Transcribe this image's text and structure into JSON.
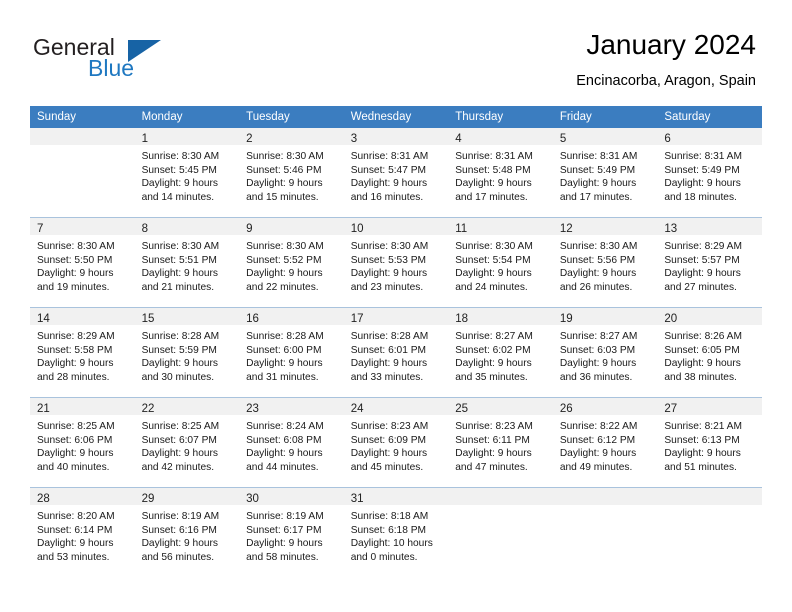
{
  "logo": {
    "word1": "General",
    "word2": "Blue",
    "triangle_color": "#1763a5",
    "blue_color": "#1f78c1"
  },
  "header": {
    "title": "January 2024",
    "subtitle": "Encinacorba, Aragon, Spain"
  },
  "theme": {
    "header_row_bg": "#3b7dc0",
    "daynum_bg": "#f1f1f1",
    "grid_line": "#a9c3dd"
  },
  "calendar": {
    "weekday_headers": [
      "Sunday",
      "Monday",
      "Tuesday",
      "Wednesday",
      "Thursday",
      "Friday",
      "Saturday"
    ],
    "weeks": [
      [
        {
          "day": "",
          "sunrise": "",
          "sunset": "",
          "daylight1": "",
          "daylight2": ""
        },
        {
          "day": "1",
          "sunrise": "Sunrise: 8:30 AM",
          "sunset": "Sunset: 5:45 PM",
          "daylight1": "Daylight: 9 hours",
          "daylight2": "and 14 minutes."
        },
        {
          "day": "2",
          "sunrise": "Sunrise: 8:30 AM",
          "sunset": "Sunset: 5:46 PM",
          "daylight1": "Daylight: 9 hours",
          "daylight2": "and 15 minutes."
        },
        {
          "day": "3",
          "sunrise": "Sunrise: 8:31 AM",
          "sunset": "Sunset: 5:47 PM",
          "daylight1": "Daylight: 9 hours",
          "daylight2": "and 16 minutes."
        },
        {
          "day": "4",
          "sunrise": "Sunrise: 8:31 AM",
          "sunset": "Sunset: 5:48 PM",
          "daylight1": "Daylight: 9 hours",
          "daylight2": "and 17 minutes."
        },
        {
          "day": "5",
          "sunrise": "Sunrise: 8:31 AM",
          "sunset": "Sunset: 5:49 PM",
          "daylight1": "Daylight: 9 hours",
          "daylight2": "and 17 minutes."
        },
        {
          "day": "6",
          "sunrise": "Sunrise: 8:31 AM",
          "sunset": "Sunset: 5:49 PM",
          "daylight1": "Daylight: 9 hours",
          "daylight2": "and 18 minutes."
        }
      ],
      [
        {
          "day": "7",
          "sunrise": "Sunrise: 8:30 AM",
          "sunset": "Sunset: 5:50 PM",
          "daylight1": "Daylight: 9 hours",
          "daylight2": "and 19 minutes."
        },
        {
          "day": "8",
          "sunrise": "Sunrise: 8:30 AM",
          "sunset": "Sunset: 5:51 PM",
          "daylight1": "Daylight: 9 hours",
          "daylight2": "and 21 minutes."
        },
        {
          "day": "9",
          "sunrise": "Sunrise: 8:30 AM",
          "sunset": "Sunset: 5:52 PM",
          "daylight1": "Daylight: 9 hours",
          "daylight2": "and 22 minutes."
        },
        {
          "day": "10",
          "sunrise": "Sunrise: 8:30 AM",
          "sunset": "Sunset: 5:53 PM",
          "daylight1": "Daylight: 9 hours",
          "daylight2": "and 23 minutes."
        },
        {
          "day": "11",
          "sunrise": "Sunrise: 8:30 AM",
          "sunset": "Sunset: 5:54 PM",
          "daylight1": "Daylight: 9 hours",
          "daylight2": "and 24 minutes."
        },
        {
          "day": "12",
          "sunrise": "Sunrise: 8:30 AM",
          "sunset": "Sunset: 5:56 PM",
          "daylight1": "Daylight: 9 hours",
          "daylight2": "and 26 minutes."
        },
        {
          "day": "13",
          "sunrise": "Sunrise: 8:29 AM",
          "sunset": "Sunset: 5:57 PM",
          "daylight1": "Daylight: 9 hours",
          "daylight2": "and 27 minutes."
        }
      ],
      [
        {
          "day": "14",
          "sunrise": "Sunrise: 8:29 AM",
          "sunset": "Sunset: 5:58 PM",
          "daylight1": "Daylight: 9 hours",
          "daylight2": "and 28 minutes."
        },
        {
          "day": "15",
          "sunrise": "Sunrise: 8:28 AM",
          "sunset": "Sunset: 5:59 PM",
          "daylight1": "Daylight: 9 hours",
          "daylight2": "and 30 minutes."
        },
        {
          "day": "16",
          "sunrise": "Sunrise: 8:28 AM",
          "sunset": "Sunset: 6:00 PM",
          "daylight1": "Daylight: 9 hours",
          "daylight2": "and 31 minutes."
        },
        {
          "day": "17",
          "sunrise": "Sunrise: 8:28 AM",
          "sunset": "Sunset: 6:01 PM",
          "daylight1": "Daylight: 9 hours",
          "daylight2": "and 33 minutes."
        },
        {
          "day": "18",
          "sunrise": "Sunrise: 8:27 AM",
          "sunset": "Sunset: 6:02 PM",
          "daylight1": "Daylight: 9 hours",
          "daylight2": "and 35 minutes."
        },
        {
          "day": "19",
          "sunrise": "Sunrise: 8:27 AM",
          "sunset": "Sunset: 6:03 PM",
          "daylight1": "Daylight: 9 hours",
          "daylight2": "and 36 minutes."
        },
        {
          "day": "20",
          "sunrise": "Sunrise: 8:26 AM",
          "sunset": "Sunset: 6:05 PM",
          "daylight1": "Daylight: 9 hours",
          "daylight2": "and 38 minutes."
        }
      ],
      [
        {
          "day": "21",
          "sunrise": "Sunrise: 8:25 AM",
          "sunset": "Sunset: 6:06 PM",
          "daylight1": "Daylight: 9 hours",
          "daylight2": "and 40 minutes."
        },
        {
          "day": "22",
          "sunrise": "Sunrise: 8:25 AM",
          "sunset": "Sunset: 6:07 PM",
          "daylight1": "Daylight: 9 hours",
          "daylight2": "and 42 minutes."
        },
        {
          "day": "23",
          "sunrise": "Sunrise: 8:24 AM",
          "sunset": "Sunset: 6:08 PM",
          "daylight1": "Daylight: 9 hours",
          "daylight2": "and 44 minutes."
        },
        {
          "day": "24",
          "sunrise": "Sunrise: 8:23 AM",
          "sunset": "Sunset: 6:09 PM",
          "daylight1": "Daylight: 9 hours",
          "daylight2": "and 45 minutes."
        },
        {
          "day": "25",
          "sunrise": "Sunrise: 8:23 AM",
          "sunset": "Sunset: 6:11 PM",
          "daylight1": "Daylight: 9 hours",
          "daylight2": "and 47 minutes."
        },
        {
          "day": "26",
          "sunrise": "Sunrise: 8:22 AM",
          "sunset": "Sunset: 6:12 PM",
          "daylight1": "Daylight: 9 hours",
          "daylight2": "and 49 minutes."
        },
        {
          "day": "27",
          "sunrise": "Sunrise: 8:21 AM",
          "sunset": "Sunset: 6:13 PM",
          "daylight1": "Daylight: 9 hours",
          "daylight2": "and 51 minutes."
        }
      ],
      [
        {
          "day": "28",
          "sunrise": "Sunrise: 8:20 AM",
          "sunset": "Sunset: 6:14 PM",
          "daylight1": "Daylight: 9 hours",
          "daylight2": "and 53 minutes."
        },
        {
          "day": "29",
          "sunrise": "Sunrise: 8:19 AM",
          "sunset": "Sunset: 6:16 PM",
          "daylight1": "Daylight: 9 hours",
          "daylight2": "and 56 minutes."
        },
        {
          "day": "30",
          "sunrise": "Sunrise: 8:19 AM",
          "sunset": "Sunset: 6:17 PM",
          "daylight1": "Daylight: 9 hours",
          "daylight2": "and 58 minutes."
        },
        {
          "day": "31",
          "sunrise": "Sunrise: 8:18 AM",
          "sunset": "Sunset: 6:18 PM",
          "daylight1": "Daylight: 10 hours",
          "daylight2": "and 0 minutes."
        },
        {
          "day": "",
          "sunrise": "",
          "sunset": "",
          "daylight1": "",
          "daylight2": ""
        },
        {
          "day": "",
          "sunrise": "",
          "sunset": "",
          "daylight1": "",
          "daylight2": ""
        },
        {
          "day": "",
          "sunrise": "",
          "sunset": "",
          "daylight1": "",
          "daylight2": ""
        }
      ]
    ]
  }
}
